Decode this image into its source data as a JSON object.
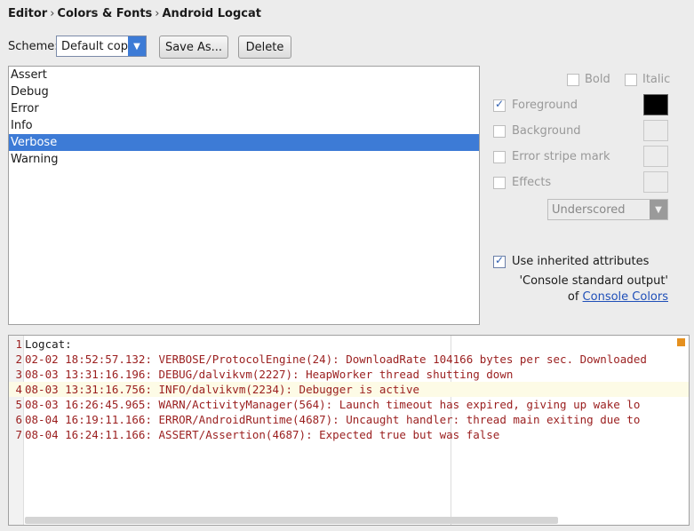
{
  "breadcrumb": [
    "Editor",
    "Colors & Fonts",
    "Android Logcat"
  ],
  "scheme": {
    "label": "Scheme:",
    "value": "Default copy",
    "save_as": "Save As...",
    "delete": "Delete"
  },
  "levels": [
    {
      "label": "Assert",
      "selected": false
    },
    {
      "label": "Debug",
      "selected": false
    },
    {
      "label": "Error",
      "selected": false
    },
    {
      "label": "Info",
      "selected": false
    },
    {
      "label": "Verbose",
      "selected": true
    },
    {
      "label": "Warning",
      "selected": false
    }
  ],
  "attributes": {
    "bold": "Bold",
    "italic": "Italic",
    "foreground": "Foreground",
    "background": "Background",
    "error_stripe": "Error stripe mark",
    "effects": "Effects",
    "effect_type": "Underscored",
    "use_inherited": "Use inherited attributes",
    "inherited_from": "'Console standard output'",
    "of_prefix": "of",
    "console_colors_link": "Console Colors",
    "foreground_color": "#000000"
  },
  "preview": {
    "lines": [
      {
        "n": "1",
        "text": "Logcat:",
        "color": "#1a1a1a"
      },
      {
        "n": "2",
        "text": "02-02 18:52:57.132: VERBOSE/ProtocolEngine(24): DownloadRate 104166 bytes per sec. Downloaded",
        "color": "#9a1e1e"
      },
      {
        "n": "3",
        "text": "08-03 13:31:16.196: DEBUG/dalvikvm(2227): HeapWorker thread shutting down",
        "color": "#9a1e1e"
      },
      {
        "n": "4",
        "text": "08-03 13:31:16.756: INFO/dalvikvm(2234): Debugger is active",
        "color": "#9a1e1e"
      },
      {
        "n": "5",
        "text": "08-03 16:26:45.965: WARN/ActivityManager(564): Launch timeout has expired, giving up wake lo",
        "color": "#9a1e1e"
      },
      {
        "n": "6",
        "text": "08-04 16:19:11.166: ERROR/AndroidRuntime(4687): Uncaught handler: thread main exiting due to",
        "color": "#9a1e1e"
      },
      {
        "n": "7",
        "text": "08-04 16:24:11.166: ASSERT/Assertion(4687): Expected true but was false",
        "color": "#9a1e1e"
      }
    ]
  }
}
